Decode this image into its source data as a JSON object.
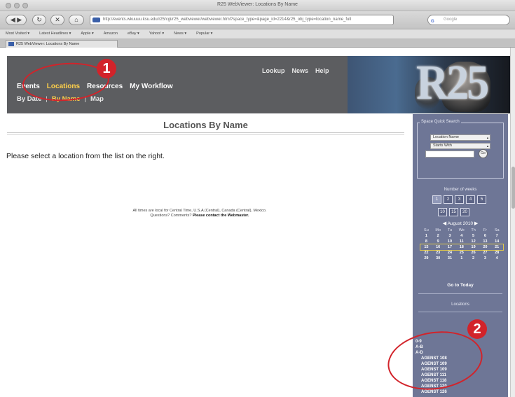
{
  "browser": {
    "window_title": "R25 WebViewer: Locations By Name",
    "url": "http://events.wkuuuu.ksu.edu/r25/cgi/r25_webviewer/webviewer.html?space_type=&page_id=2214&r25_obj_type=location_name_full",
    "search_placeholder": "Google",
    "bookmarks": [
      "Most Visited ▾",
      "Latest Headlines ▾",
      "Apple ▾",
      "Amazon",
      "eBay ▾",
      "Yahoo! ▾",
      "News ▾",
      "Popular ▾"
    ],
    "tab_title": "R25 WebViewer: Locations By Name",
    "nav_labels": {
      "back": "◀",
      "forward": "▶",
      "reload": "↻",
      "stop": "✕",
      "home": "⌂"
    }
  },
  "header": {
    "logo_text": "R25",
    "top_links": [
      "Lookup",
      "News",
      "Help"
    ],
    "main_nav": [
      {
        "label": "Events",
        "active": false
      },
      {
        "label": "Locations",
        "active": true
      },
      {
        "label": "Resources",
        "active": false
      },
      {
        "label": "My Workflow",
        "active": false
      }
    ],
    "sub_nav": [
      {
        "label": "By Date",
        "active": false
      },
      {
        "label": "By Name",
        "active": true
      },
      {
        "label": "Map",
        "active": false
      }
    ]
  },
  "main": {
    "title": "Locations By Name",
    "instruction": "Please select a location from the list on the right.",
    "footer_line1": "All times are local for Central Time, U.S.A (Central), Canada (Central), Mexico.",
    "footer_line2_prefix": "Questions? Comments?",
    "footer_line2_link": "Please contact the Webmaster."
  },
  "sidebar": {
    "quick_search_title": "Space Quick Search",
    "select1_value": "Location Name",
    "select2_value": "Starts With",
    "search_value": "",
    "go_label": "Go",
    "weeks_label": "Number of weeks",
    "weeks_row1": [
      "1",
      "2",
      "3",
      "4",
      "5"
    ],
    "weeks_row2": [
      "10",
      "15",
      "20"
    ],
    "selected_week": "1",
    "month_label": "August 2010",
    "day_headers": [
      "Su",
      "Mo",
      "Tu",
      "We",
      "Th",
      "Fr",
      "Sa"
    ],
    "calendar_rows": [
      [
        "1",
        "2",
        "3",
        "4",
        "5",
        "6",
        "7"
      ],
      [
        "8",
        "9",
        "10",
        "11",
        "12",
        "13",
        "14"
      ],
      [
        "15",
        "16",
        "17",
        "18",
        "19",
        "20",
        "21"
      ],
      [
        "22",
        "23",
        "24",
        "25",
        "26",
        "27",
        "28"
      ],
      [
        "29",
        "30",
        "31",
        "1",
        "2",
        "3",
        "4"
      ]
    ],
    "current_week_index": 2,
    "goto_today": "Go to Today",
    "locations_label": "Locations",
    "alpha_groups": [
      "0-9",
      "A-B"
    ],
    "alpha_group_expanded": "A-D",
    "locations": [
      "AGENST 108",
      "AGENST 109",
      "AGENST 109",
      "AGENST 111",
      "AGENST 118",
      "AGENST 120",
      "AGENST 126"
    ]
  },
  "callouts": [
    "1",
    "2"
  ],
  "colors": {
    "header_bg": "#5c5d60",
    "active_nav": "#ffd04a",
    "sidebar_bg": "#6e7696",
    "callout_red": "#d2232a"
  }
}
